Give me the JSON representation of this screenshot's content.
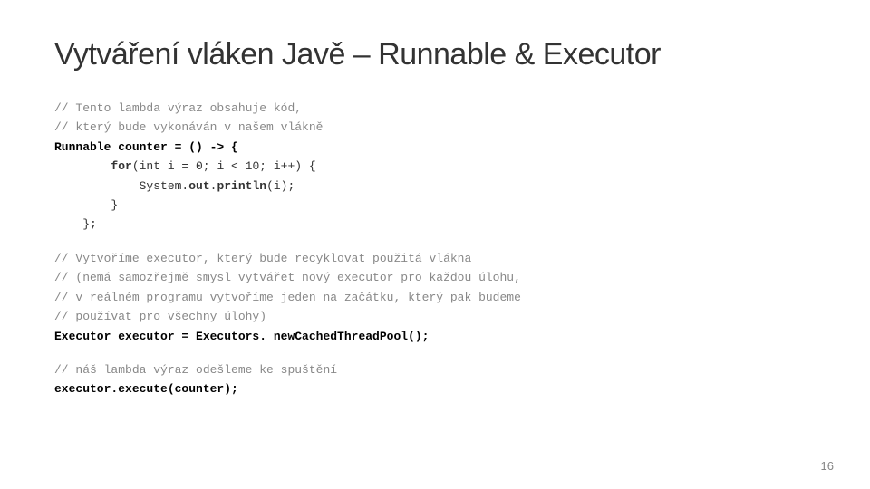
{
  "slide": {
    "title": "Vytváření vláken Javě – Runnable & Executor",
    "slide_number": "16",
    "code_sections": [
      {
        "id": "section1",
        "lines": [
          {
            "type": "comment",
            "text": "// Tento lambda výraz obsahuje kód,"
          },
          {
            "type": "comment",
            "text": "// který bude vykonáván v našem vlákně"
          },
          {
            "type": "bold",
            "text": "Runnable counter = () -> {"
          },
          {
            "type": "normal",
            "text": "        for(int i = 0; i < 10; i++) {"
          },
          {
            "type": "bold-inner",
            "text": "            System.out.println(i);"
          },
          {
            "type": "normal",
            "text": "        }"
          },
          {
            "type": "normal",
            "text": "    };"
          }
        ]
      },
      {
        "id": "section2",
        "lines": [
          {
            "type": "comment",
            "text": "// Vytvoříme executor, který bude recyklovat použitá vlákna"
          },
          {
            "type": "comment",
            "text": "// (nemá samozřejmě smysl vytvářet nový executor pro každou úlohu,"
          },
          {
            "type": "comment",
            "text": "// v reálném programu vytvoříme jeden na začátku, který pak budeme"
          },
          {
            "type": "comment",
            "text": "// používat pro všechny úlohy)"
          },
          {
            "type": "bold",
            "text": "Executor executor = Executors. newCachedThreadPool();"
          }
        ]
      },
      {
        "id": "section3",
        "lines": [
          {
            "type": "comment",
            "text": "// náš lambda výraz odešleme ke spuštění"
          },
          {
            "type": "bold",
            "text": "executor.execute(counter);"
          }
        ]
      }
    ]
  }
}
